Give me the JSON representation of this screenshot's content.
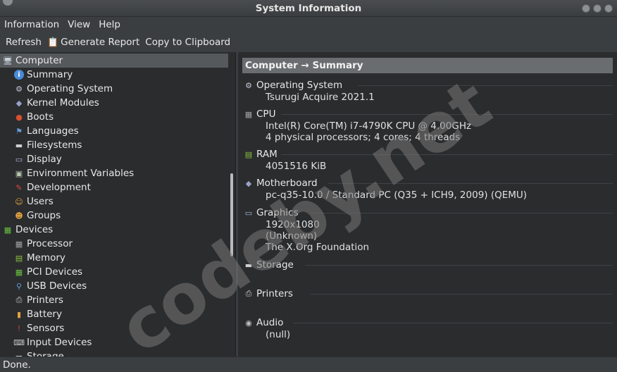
{
  "window": {
    "title": "System Information"
  },
  "menu": [
    "Information",
    "View",
    "Help"
  ],
  "toolbar": {
    "refresh": "Refresh",
    "generate": "Generate Report",
    "copy": "Copy to Clipboard"
  },
  "tree": [
    {
      "label": "Computer",
      "level": 0,
      "icon": "computer-icon",
      "glyph": "🖥",
      "color": "#c8d0d8",
      "selected": true
    },
    {
      "label": "Summary",
      "level": 1,
      "icon": "info-icon",
      "glyph": "i",
      "color": "#4a8ad8"
    },
    {
      "label": "Operating System",
      "level": 1,
      "icon": "gear-icon",
      "glyph": "⚙",
      "color": "#c8c8d8"
    },
    {
      "label": "Kernel Modules",
      "level": 1,
      "icon": "module-icon",
      "glyph": "◆",
      "color": "#9aa0c8"
    },
    {
      "label": "Boots",
      "level": 1,
      "icon": "boot-icon",
      "glyph": "●",
      "color": "#d85030"
    },
    {
      "label": "Languages",
      "level": 1,
      "icon": "flag-icon",
      "glyph": "⚑",
      "color": "#6a9ad8"
    },
    {
      "label": "Filesystems",
      "level": 1,
      "icon": "drive-icon",
      "glyph": "▬",
      "color": "#cfcfcf"
    },
    {
      "label": "Display",
      "level": 1,
      "icon": "monitor-icon",
      "glyph": "▭",
      "color": "#a8b8d8"
    },
    {
      "label": "Environment Variables",
      "level": 1,
      "icon": "terminal-icon",
      "glyph": "▣",
      "color": "#b8c8b0"
    },
    {
      "label": "Development",
      "level": 1,
      "icon": "development-icon",
      "glyph": "✎",
      "color": "#e04a3a"
    },
    {
      "label": "Users",
      "level": 1,
      "icon": "user-icon",
      "glyph": "☺",
      "color": "#e0a040"
    },
    {
      "label": "Groups",
      "level": 1,
      "icon": "group-icon",
      "glyph": "☻",
      "color": "#e0a040"
    },
    {
      "label": "Devices",
      "level": 0,
      "icon": "devices-icon",
      "glyph": "▦",
      "color": "#6ac040"
    },
    {
      "label": "Processor",
      "level": 1,
      "icon": "cpu-icon",
      "glyph": "▦",
      "color": "#a0a0a0"
    },
    {
      "label": "Memory",
      "level": 1,
      "icon": "memory-icon",
      "glyph": "▤",
      "color": "#8ac040"
    },
    {
      "label": "PCI Devices",
      "level": 1,
      "icon": "pci-icon",
      "glyph": "▦",
      "color": "#6ac040"
    },
    {
      "label": "USB Devices",
      "level": 1,
      "icon": "usb-icon",
      "glyph": "⚲",
      "color": "#6a9ad8"
    },
    {
      "label": "Printers",
      "level": 1,
      "icon": "printer-icon",
      "glyph": "⎙",
      "color": "#d0d0d0"
    },
    {
      "label": "Battery",
      "level": 1,
      "icon": "battery-icon",
      "glyph": "▮",
      "color": "#e0a040"
    },
    {
      "label": "Sensors",
      "level": 1,
      "icon": "thermometer-icon",
      "glyph": "!",
      "color": "#d04040"
    },
    {
      "label": "Input Devices",
      "level": 1,
      "icon": "input-icon",
      "glyph": "⌨",
      "color": "#c0c0c0"
    },
    {
      "label": "Storage",
      "level": 1,
      "icon": "storage-icon",
      "glyph": "▬",
      "color": "#cfcfcf"
    }
  ],
  "main": {
    "header": "Computer → Summary",
    "sections": [
      {
        "title": "Operating System",
        "icon": "gear-icon",
        "glyph": "⚙",
        "color": "#c8c8d8",
        "values": [
          "Tsurugi Acquire 2021.1"
        ]
      },
      {
        "title": "CPU",
        "icon": "cpu-icon",
        "glyph": "▦",
        "color": "#a0a0a0",
        "values": [
          "Intel(R) Core(TM) i7-4790K CPU @ 4.00GHz",
          "4 physical processors; 4 cores; 4 threads"
        ]
      },
      {
        "title": "RAM",
        "icon": "memory-icon",
        "glyph": "▤",
        "color": "#8ac040",
        "values": [
          "4051516 KiB"
        ]
      },
      {
        "title": "Motherboard",
        "icon": "motherboard-icon",
        "glyph": "◆",
        "color": "#9aa0c8",
        "values": [
          "pc-q35-10.0 / Standard PC (Q35 + ICH9, 2009) (QEMU)"
        ]
      },
      {
        "title": "Graphics",
        "icon": "monitor-icon",
        "glyph": "▭",
        "color": "#a8b8d8",
        "values": [
          "1920x1080",
          "(Unknown)",
          "The X.Org Foundation"
        ]
      },
      {
        "title": "Storage",
        "icon": "storage-icon",
        "glyph": "▬",
        "color": "#cfcfcf",
        "values": []
      },
      {
        "title": "Printers",
        "icon": "printer-icon",
        "glyph": "⎙",
        "color": "#d0d0d0",
        "values": []
      },
      {
        "title": "Audio",
        "icon": "audio-icon",
        "glyph": "◉",
        "color": "#c0c0c0",
        "values": [
          "(null)"
        ]
      }
    ]
  },
  "status": "Done.",
  "watermark": "codeby.net"
}
